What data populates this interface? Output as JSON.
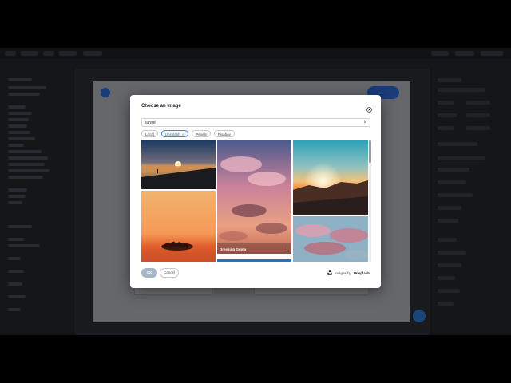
{
  "dialog": {
    "title": "Choose an Image",
    "search_value": "sunset",
    "search_clear": "×",
    "sources": [
      {
        "label": "Local",
        "active": false
      },
      {
        "label": "Unsplash",
        "active": true
      },
      {
        "label": "Pexels",
        "active": false
      },
      {
        "label": "Pixabay",
        "active": false
      }
    ],
    "active_check": "✓",
    "images": [
      {
        "subject": "beach-sunset-road"
      },
      {
        "subject": "pink-clouds-sky",
        "caption": "Dressing Gepta"
      },
      {
        "subject": "mountain-sunset"
      },
      {
        "subject": "tree-island-orange-sky"
      },
      {
        "subject": "pink-clouds-blue-sky"
      },
      {
        "subject": "partial-blue-sky"
      }
    ],
    "ok_label": "OK",
    "cancel_label": "Cancel",
    "credit_prefix": "Images by",
    "credit_brand": "Unsplash"
  },
  "colors": {
    "accent": "#2f6fe0",
    "chip_active": "#3f8bd6",
    "ok_button": "#a6b6c7"
  },
  "icons": {
    "close": "close-icon",
    "unsplash": "unsplash-logo-icon",
    "more": "more-vertical-icon"
  }
}
